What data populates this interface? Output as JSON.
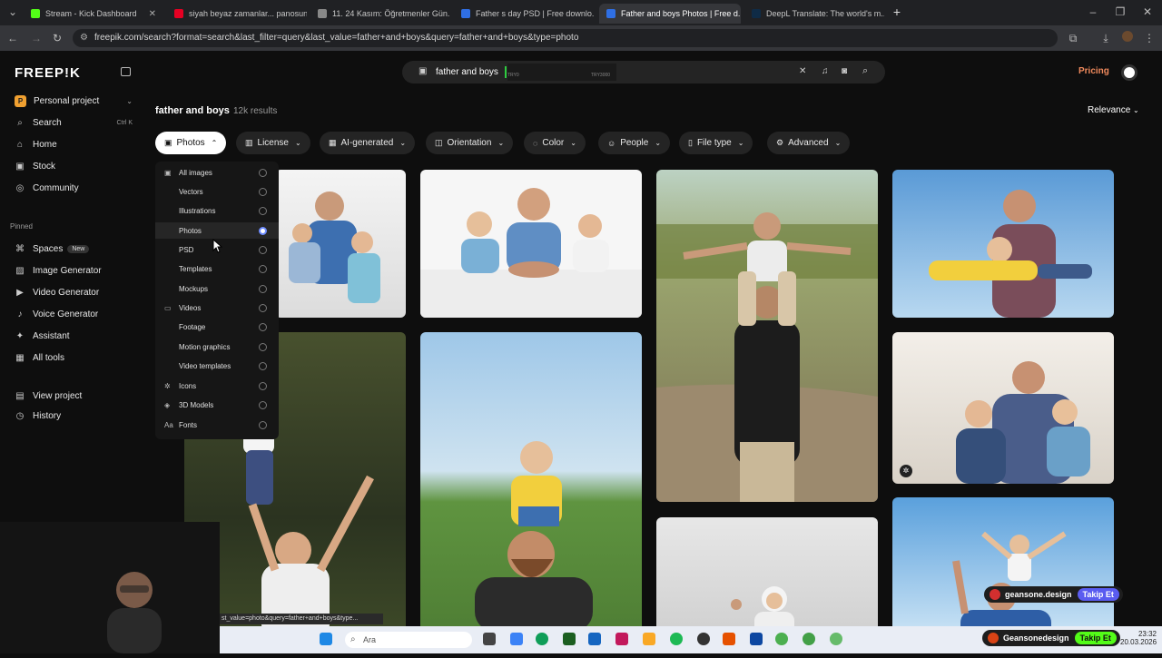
{
  "browser": {
    "tabs": [
      {
        "title": "Stream - Kick Dashboard",
        "fav": "#53fc18"
      },
      {
        "title": "siyah beyaz zamanlar... panosunu",
        "fav": "#e60023"
      },
      {
        "title": "11. 24 Kasım: Öğretmenler Gün...",
        "fav": "#888888"
      },
      {
        "title": "Father s day PSD | Free downlo...",
        "fav": "#2f6fe4"
      },
      {
        "title": "Father and boys Photos | Free d...",
        "fav": "#2f6fe4"
      },
      {
        "title": "DeepL Translate: The world's m...",
        "fav": "#0f2b46"
      }
    ],
    "url": "freepik.com/search?format=search&last_filter=query&last_value=father+and+boys&query=father+and+boys&type=photo",
    "status_url": "st_value=photo&query=father+and+boys&type..."
  },
  "sidebar": {
    "logo": "FREEP!K",
    "project": "Personal project",
    "items": [
      {
        "label": "Search",
        "icon": "search-icon",
        "shortcut": "Ctrl K"
      },
      {
        "label": "Home",
        "icon": "home-icon"
      },
      {
        "label": "Stock",
        "icon": "stock-icon"
      },
      {
        "label": "Community",
        "icon": "globe-icon"
      }
    ],
    "pinned_label": "Pinned",
    "pinned": [
      {
        "label": "Spaces",
        "icon": "spaces-icon",
        "badge": "New"
      },
      {
        "label": "Image Generator",
        "icon": "image-icon"
      },
      {
        "label": "Video Generator",
        "icon": "video-icon"
      },
      {
        "label": "Voice Generator",
        "icon": "voice-icon"
      },
      {
        "label": "Assistant",
        "icon": "assistant-icon"
      },
      {
        "label": "All tools",
        "icon": "grid-icon"
      }
    ],
    "bottom": [
      {
        "label": "View project",
        "icon": "project-icon"
      },
      {
        "label": "History",
        "icon": "history-icon"
      }
    ]
  },
  "search": {
    "query": "father and boys",
    "overlay_left": "TRY0",
    "overlay_right": "TRY3000"
  },
  "header": {
    "pricing": "Pricing",
    "title": "father and boys",
    "results": "12k results",
    "sort": "Relevance"
  },
  "filters": [
    {
      "label": "Photos",
      "icon": "photo-icon",
      "active": true
    },
    {
      "label": "License",
      "icon": "license-icon"
    },
    {
      "label": "AI-generated",
      "icon": "ai-icon"
    },
    {
      "label": "Orientation",
      "icon": "orientation-icon"
    },
    {
      "label": "Color",
      "icon": "color-icon"
    },
    {
      "label": "People",
      "icon": "people-icon"
    },
    {
      "label": "File type",
      "icon": "file-icon"
    },
    {
      "label": "Advanced",
      "icon": "advanced-icon"
    }
  ],
  "dropdown": [
    {
      "label": "All images",
      "icon": "images-icon",
      "selected": false,
      "top_level": true
    },
    {
      "label": "Vectors",
      "selected": false
    },
    {
      "label": "Illustrations",
      "selected": false
    },
    {
      "label": "Photos",
      "selected": true
    },
    {
      "label": "PSD",
      "selected": false
    },
    {
      "label": "Templates",
      "selected": false
    },
    {
      "label": "Mockups",
      "selected": false
    },
    {
      "label": "Videos",
      "icon": "video-icon",
      "selected": false,
      "top_level": true
    },
    {
      "label": "Footage",
      "selected": false
    },
    {
      "label": "Motion graphics",
      "selected": false
    },
    {
      "label": "Video templates",
      "selected": false
    },
    {
      "label": "Icons",
      "icon": "icons-icon",
      "selected": false,
      "top_level": true
    },
    {
      "label": "3D Models",
      "icon": "cube-icon",
      "selected": false,
      "top_level": true
    },
    {
      "label": "Fonts",
      "icon": "font-icon",
      "selected": false,
      "top_level": true
    }
  ],
  "taskbar": {
    "search_placeholder": "Ara",
    "clock_time": "23:32",
    "clock_date": "20.03.2026",
    "live_1_name": "geansone.design",
    "live_1_action": "Takip Et",
    "live_2_name": "Geansonedesign",
    "live_2_action": "Takip Et"
  }
}
